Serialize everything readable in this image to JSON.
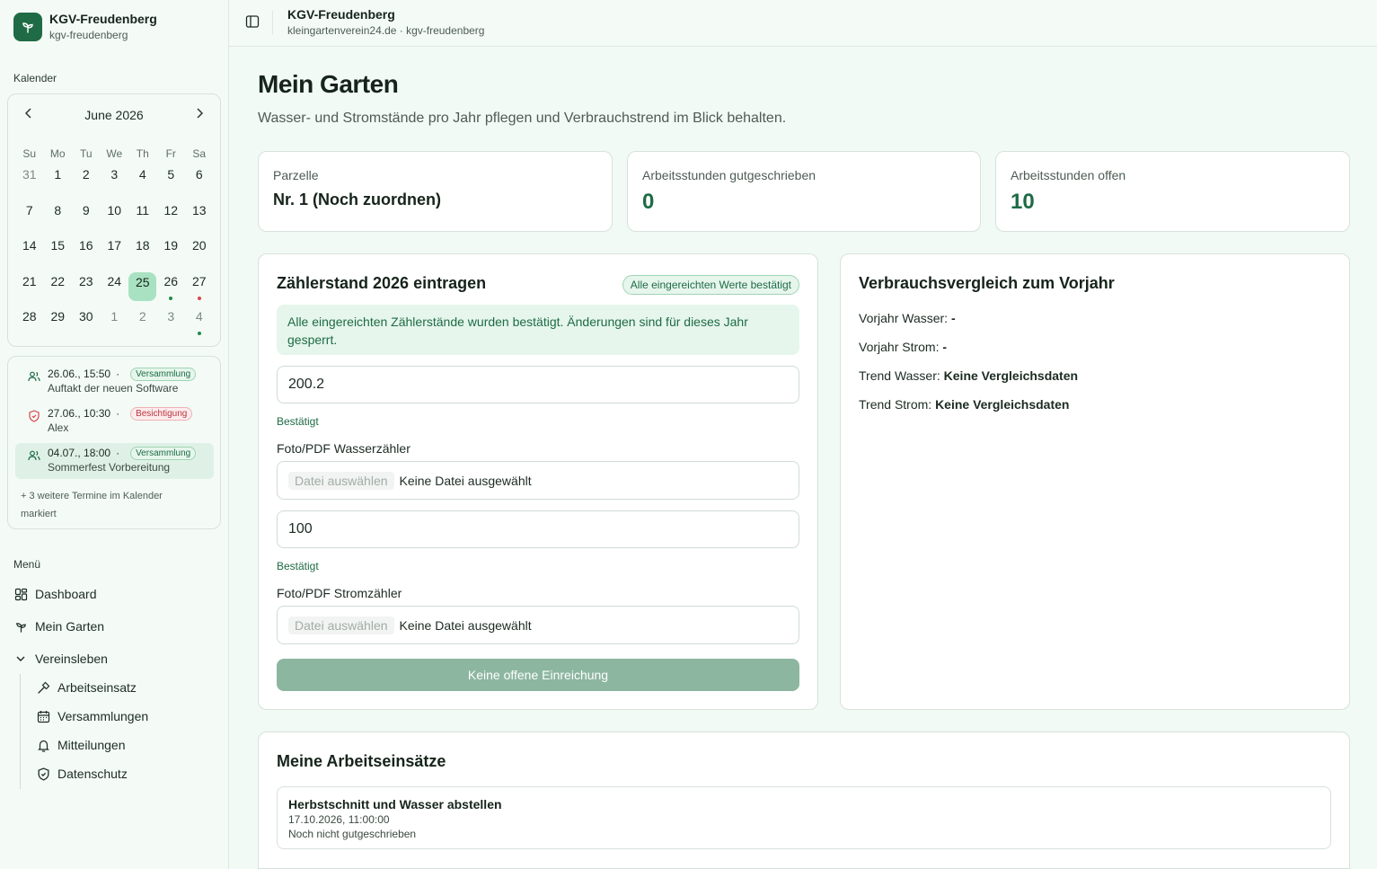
{
  "brand": {
    "name": "KGV-Freudenberg",
    "slug": "kgv-freudenberg"
  },
  "header": {
    "title": "KGV-Freudenberg",
    "subtitle": "kleingartenverein24.de · kgv-freudenberg"
  },
  "calendar": {
    "section_label": "Kalender",
    "month_label": "June 2026",
    "weekdays": [
      "Su",
      "Mo",
      "Tu",
      "We",
      "Th",
      "Fr",
      "Sa"
    ],
    "weeks": [
      [
        "31",
        "1",
        "2",
        "3",
        "4",
        "5",
        "6"
      ],
      [
        "7",
        "8",
        "9",
        "10",
        "11",
        "12",
        "13"
      ],
      [
        "14",
        "15",
        "16",
        "17",
        "18",
        "19",
        "20"
      ],
      [
        "21",
        "22",
        "23",
        "24",
        "25",
        "26",
        "27"
      ],
      [
        "28",
        "29",
        "30",
        "1",
        "2",
        "3",
        "4"
      ]
    ],
    "today": "25"
  },
  "events": [
    {
      "datetime": "26.06., 15:50",
      "badge": "Versammlung",
      "title": "Auftakt der neuen Software"
    },
    {
      "datetime": "27.06., 10:30",
      "badge": "Besichtigung",
      "title": "Alex"
    },
    {
      "datetime": "04.07., 18:00",
      "badge": "Versammlung",
      "title": "Sommerfest Vorbereitung"
    }
  ],
  "events_more": "+ 3 weitere Termine im Kalender markiert",
  "menu": {
    "section_label": "Menü",
    "dashboard": "Dashboard",
    "mein_garten": "Mein Garten",
    "vereinsleben": "Vereinsleben",
    "arbeitseinsatz": "Arbeitseinsatz",
    "versammlungen": "Versammlungen",
    "mitteilungen": "Mitteilungen",
    "datenschutz": "Datenschutz"
  },
  "page": {
    "title": "Mein Garten",
    "subtitle": "Wasser- und Stromstände pro Jahr pflegen und Verbrauchstrend im Blick behalten."
  },
  "stats": {
    "parzelle_label": "Parzelle",
    "parzelle_value": "Nr. 1 (Noch zuordnen)",
    "credited_label": "Arbeitsstunden gutgeschrieben",
    "credited_value": "0",
    "open_label": "Arbeitsstunden offen",
    "open_value": "10"
  },
  "meter": {
    "title": "Zählerstand 2026 eintragen",
    "badge": "Alle eingereichten Werte bestätigt",
    "alert": "Alle eingereichten Zählerstände wurden bestätigt. Änderungen sind für dieses Jahr gesperrt.",
    "water_value": "200.2",
    "water_status": "Bestätigt",
    "water_file_label": "Foto/PDF Wasserzähler",
    "power_value": "100",
    "power_status": "Bestätigt",
    "power_file_label": "Foto/PDF Stromzähler",
    "file_button": "Datei auswählen",
    "file_none": "Keine Datei ausgewählt",
    "submit": "Keine offene Einreichung"
  },
  "comparison": {
    "title": "Verbrauchsvergleich zum Vorjahr",
    "water_prev_label": "Vorjahr Wasser:",
    "water_prev_value": "-",
    "power_prev_label": "Vorjahr Strom:",
    "power_prev_value": "-",
    "water_trend_label": "Trend Wasser:",
    "water_trend_value": "Keine Vergleichsdaten",
    "power_trend_label": "Trend Strom:",
    "power_trend_value": "Keine Vergleichsdaten"
  },
  "jobs": {
    "title": "Meine Arbeitseinsätze",
    "items": [
      {
        "title": "Herbstschnitt und Wasser abstellen",
        "date": "17.10.2026, 11:00:00",
        "status": "Noch nicht gutgeschrieben"
      }
    ]
  },
  "colors": {
    "accent": "#1e6b45",
    "today": "#a9e2c2",
    "dot_green": "#1f8a4c",
    "dot_red": "#d9434a"
  }
}
